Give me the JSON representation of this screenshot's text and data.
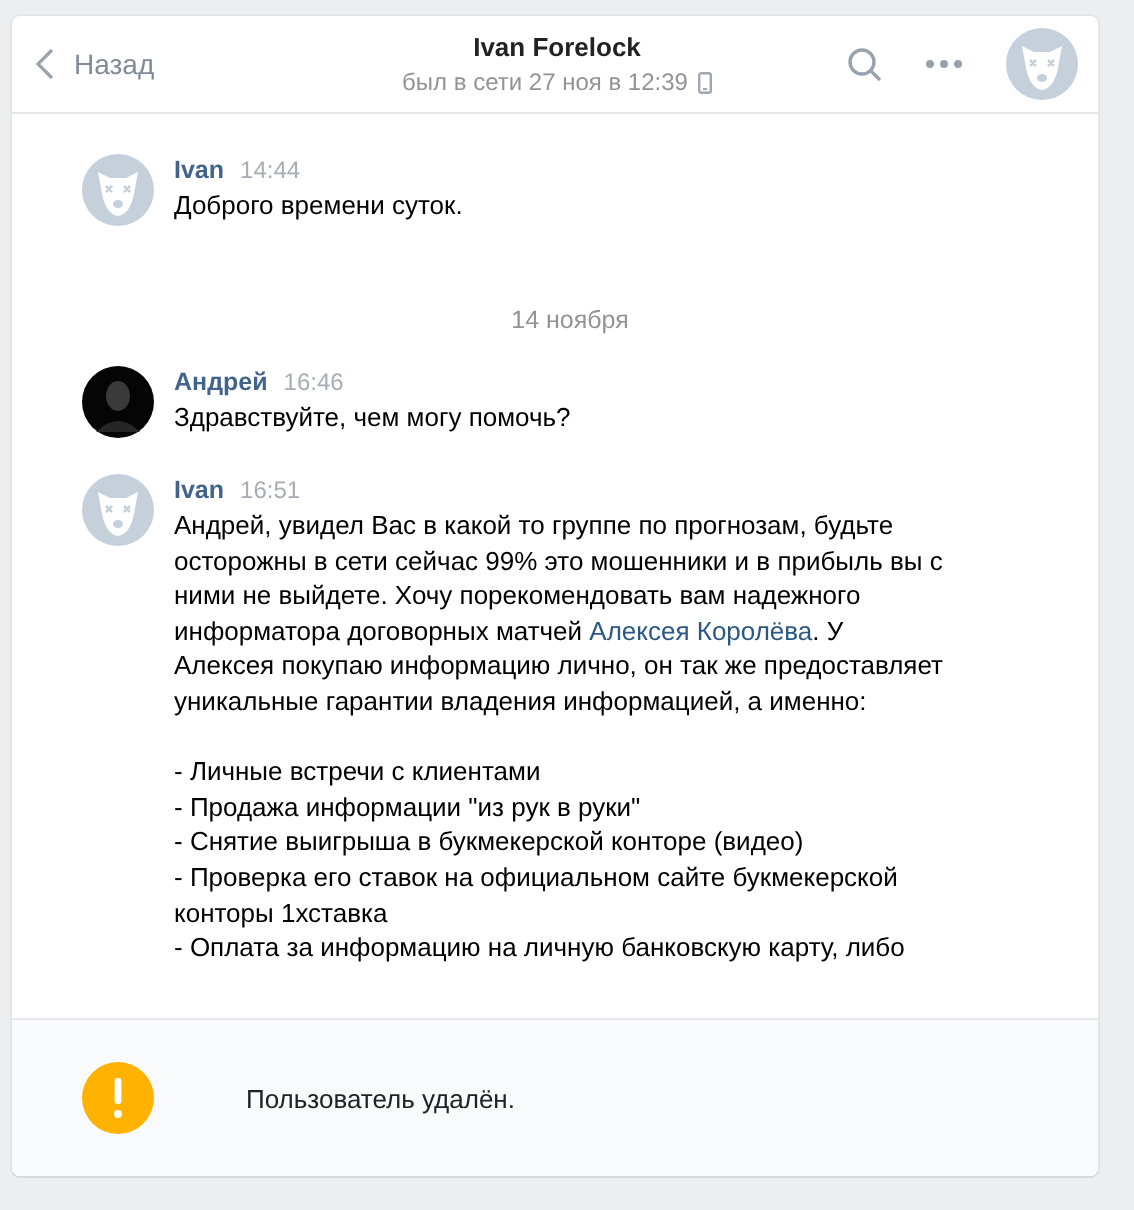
{
  "header": {
    "back": "Назад",
    "title": "Ivan Forelock",
    "status": "был в сети 27 ноя в 12:39"
  },
  "feed": [
    {
      "kind": "message",
      "author": "Ivan",
      "time": "14:44",
      "deleted_user": true,
      "body": [
        {
          "segments": [
            {
              "text": "Доброго времени суток."
            }
          ]
        }
      ]
    },
    {
      "kind": "date",
      "text": "14 ноября"
    },
    {
      "kind": "message",
      "author": "Андрей",
      "time": "16:46",
      "deleted_user": false,
      "body": [
        {
          "segments": [
            {
              "text": "Здравствуйте, чем могу помочь?"
            }
          ]
        }
      ]
    },
    {
      "kind": "message",
      "author": "Ivan",
      "time": "16:51",
      "deleted_user": true,
      "body": [
        {
          "segments": [
            {
              "text": "Андрей, увидел Вас в какой то группе по прогнозам, будьте осторожны в сети сейчас 99% это мошенники и в прибыль вы с ними не выйдете. Хочу порекомендовать вам надежного информатора договорных матчей "
            },
            {
              "text": "Алексея Королёва",
              "link": true
            },
            {
              "text": ". У Алексея покупаю информацию лично, он так же предоставляет уникальные гарантии владения информацией, а именно:"
            }
          ]
        },
        {
          "blank_line_before": true,
          "segments": [
            {
              "text": "- Личные встречи с клиентами"
            }
          ]
        },
        {
          "segments": [
            {
              "text": "- Продажа информации \"из рук в руки\""
            }
          ]
        },
        {
          "segments": [
            {
              "text": "- Снятие выигрыша в букмекерской конторе (видео)"
            }
          ]
        },
        {
          "segments": [
            {
              "text": "- Проверка его ставок на официальном сайте букмекерской конторы 1хставка"
            }
          ]
        },
        {
          "segments": [
            {
              "text": "- Оплата за информацию на личную банковскую карту, либо"
            }
          ]
        }
      ]
    }
  ],
  "notice": {
    "text": "Пользователь удалён."
  }
}
